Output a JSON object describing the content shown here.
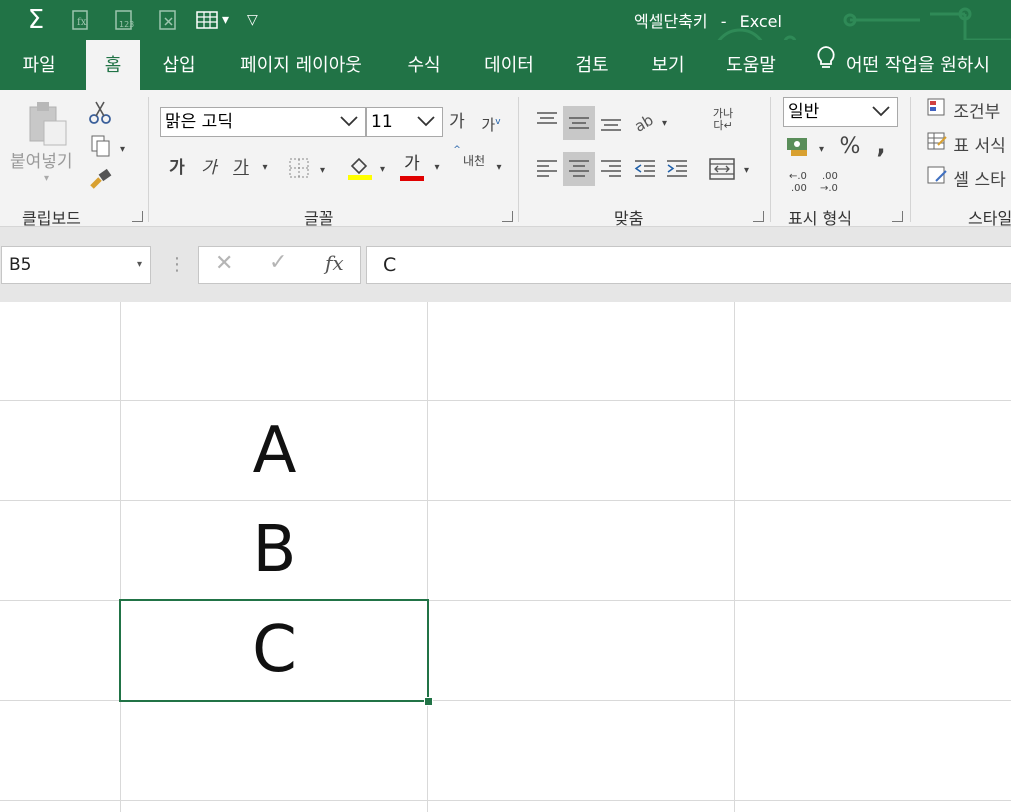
{
  "window": {
    "doc_title": "엑셀단축키",
    "separator": "-",
    "app_name": "Excel"
  },
  "qat": {
    "sum_glyph": "Σ",
    "dropdown_glyph": "▾",
    "customize_glyph": "▽"
  },
  "tabs": [
    "파일",
    "홈",
    "삽입",
    "페이지 레이아웃",
    "수식",
    "데이터",
    "검토",
    "보기",
    "도움말"
  ],
  "tell_me": "어떤 작업을 원하시",
  "clipboard": {
    "paste_label": "붙여넣기",
    "group": "클립보드"
  },
  "font": {
    "name": "맑은 고딕",
    "size": "11",
    "group": "글꼴",
    "grow": "가",
    "shrink": "가",
    "bold": "가",
    "italic": "가",
    "underline": "가",
    "font_color_glyph": "가",
    "phonetic": "내천",
    "highlight_color": "#ffff00",
    "font_color": "#e00000"
  },
  "alignment": {
    "group": "맞춤",
    "wrap_label_top": "가나",
    "wrap_label_bottom": "다↵"
  },
  "number": {
    "format": "일반",
    "group": "표시 형식",
    "percent": "%",
    "comma": ",",
    "inc_decimal": "←.0\n.00",
    "dec_decimal": ".00\n→.0"
  },
  "styles": {
    "conditional": "조건부",
    "table": "표 서식",
    "cell": "셀 스타",
    "group": "스타일"
  },
  "formula_bar": {
    "name_box": "B5",
    "cancel": "✕",
    "enter": "✓",
    "fx": "fx",
    "content": "C",
    "more": "⋮"
  },
  "sheet": {
    "cells": [
      "A",
      "B",
      "C"
    ]
  },
  "colors": {
    "brand_green": "#217346",
    "ribbon_bg": "#f3f3f3"
  }
}
